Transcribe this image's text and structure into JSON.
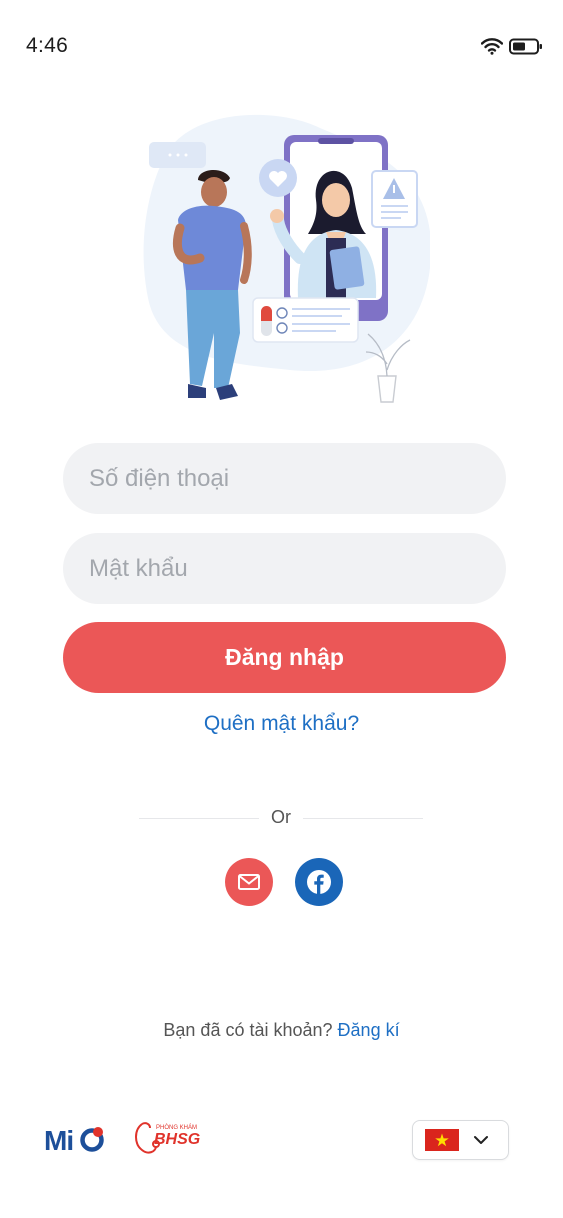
{
  "status_bar": {
    "time": "4:46"
  },
  "login_form": {
    "phone_placeholder": "Số điện thoại",
    "phone_value": "",
    "password_placeholder": "Mật khẩu",
    "password_value": "",
    "login_label": "Đăng nhập",
    "forgot_label": "Quên mật khẩu?"
  },
  "divider": {
    "label": "Or"
  },
  "social": {
    "email_icon": "email-icon",
    "facebook_icon": "facebook-icon"
  },
  "signup": {
    "prompt": "Bạn đã có tài khoản? ",
    "link_label": "Đăng kí"
  },
  "footer": {
    "mio_logo_text": "MIO",
    "bhsg_logo_text": "BHSG",
    "bhsg_logo_subtext": "PHÒNG KHÁM",
    "language_flag": "vietnam-flag-icon"
  },
  "colors": {
    "primary": "#eb5757",
    "link": "#1e6fc4",
    "facebook": "#1a66b8",
    "input_bg": "#f1f2f4"
  }
}
